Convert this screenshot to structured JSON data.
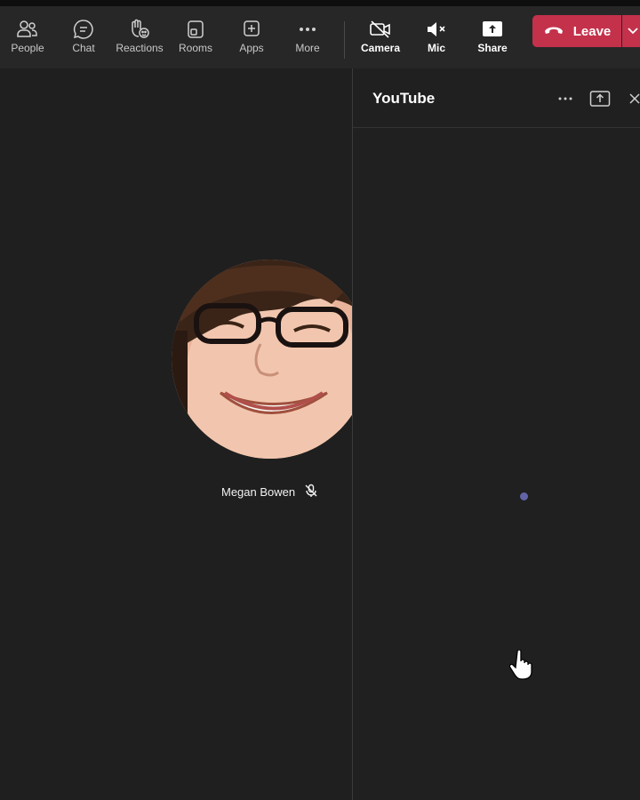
{
  "toolbar": {
    "people": "People",
    "chat": "Chat",
    "reactions": "Reactions",
    "rooms": "Rooms",
    "apps": "Apps",
    "more": "More",
    "camera": "Camera",
    "mic": "Mic",
    "share": "Share",
    "leave": "Leave"
  },
  "participant": {
    "name": "Megan Bowen",
    "muted": true
  },
  "side_panel": {
    "title": "YouTube",
    "loading": true
  },
  "colors": {
    "leave": "#c4314b",
    "accent": "#6264a7",
    "background": "#1f1f1f"
  }
}
